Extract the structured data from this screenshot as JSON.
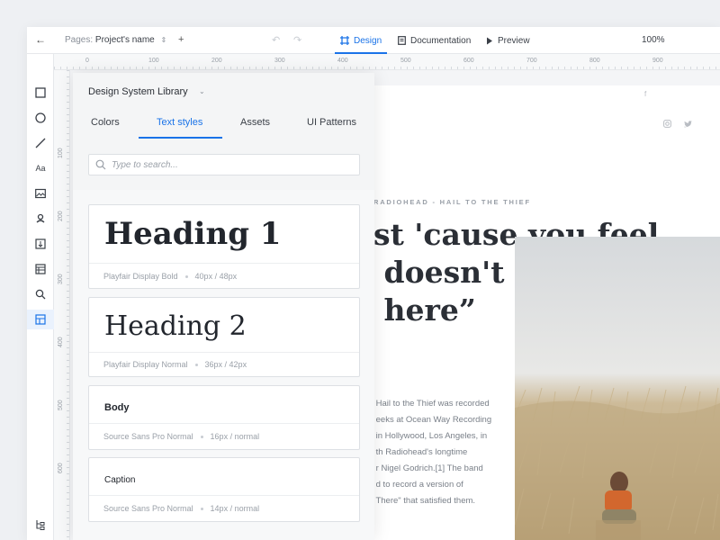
{
  "topbar": {
    "back_icon": "arrow-left-icon",
    "pages_label": "Pages:",
    "project_name": "Project's name",
    "tabs": [
      {
        "label": "Design",
        "icon": "frame-icon",
        "active": true
      },
      {
        "label": "Documentation",
        "icon": "document-icon",
        "active": false
      },
      {
        "label": "Preview",
        "icon": "play-icon",
        "active": false
      }
    ],
    "zoom": "100%"
  },
  "toolbar": {
    "tools": [
      "rectangle-icon",
      "ellipse-icon",
      "line-icon",
      "text-icon",
      "image-icon",
      "component-icon",
      "export-icon",
      "layout-icon",
      "search-icon",
      "library-icon"
    ],
    "active_tool": "library-icon",
    "bottom_tool": "layers-icon",
    "text_tool_label": "Aa"
  },
  "ruler": {
    "horizontal": [
      "0",
      "100",
      "200",
      "300",
      "400",
      "500",
      "600",
      "700",
      "800",
      "900"
    ],
    "vertical": [
      "100",
      "200",
      "300",
      "400",
      "500",
      "600"
    ]
  },
  "library": {
    "title": "Design System Library",
    "tabs": [
      "Colors",
      "Text styles",
      "Assets",
      "UI Patterns"
    ],
    "active_tab": "Text styles",
    "search_placeholder": "Type to search...",
    "styles": [
      {
        "sample": "Heading 1",
        "font": "Playfair Display Bold",
        "size": "40px / 48px"
      },
      {
        "sample": "Heading 2",
        "font": "Playfair Display Normal",
        "size": "36px / 42px"
      },
      {
        "sample": "Body",
        "font": "Source Sans Pro Normal",
        "size": "16px / normal"
      },
      {
        "sample": "Caption",
        "font": "Source Sans Pro Normal",
        "size": "14px / normal"
      }
    ]
  },
  "canvas": {
    "social_icons": [
      "facebook-icon",
      "instagram-icon",
      "twitter-icon"
    ],
    "overline": "RADIOHEAD - HAIL TO THE THIEF",
    "quote": "st 'cause you feel\n doesn't mean it's\n here”",
    "body": " Hail to the Thief was recorded\n eeks at Ocean Way Recording\n in Hollywood, Los Angeles, in\n th Radiohead's longtime\n r Nigel Godrich.[1] The band\n d to record a version of\n There\" that satisfied them."
  },
  "colors": {
    "accent": "#1a73e8",
    "text": "#2b2f36",
    "muted": "#9aa0a8"
  }
}
